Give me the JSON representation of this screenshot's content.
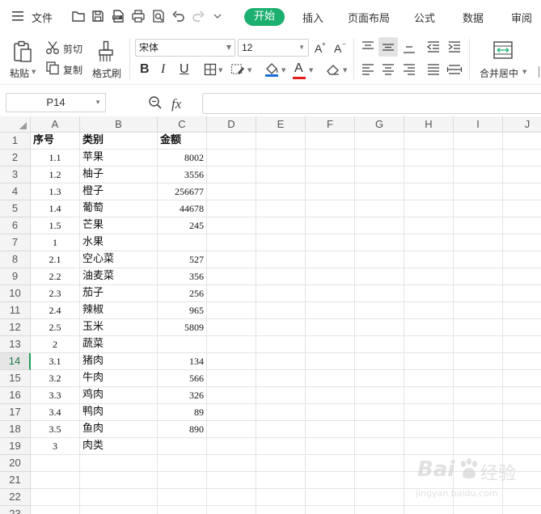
{
  "menubar": {
    "menu_label": "文件",
    "tabs": [
      {
        "label": "开始",
        "active": true
      },
      {
        "label": "插入",
        "active": false
      },
      {
        "label": "页面布局",
        "active": false
      },
      {
        "label": "公式",
        "active": false
      },
      {
        "label": "数据",
        "active": false
      },
      {
        "label": "审阅",
        "active": false
      }
    ],
    "accent_color": "#1bb070"
  },
  "ribbon": {
    "paste_label": "粘贴",
    "cut_label": "剪切",
    "copy_label": "复制",
    "format_painter_label": "格式刷",
    "font_name": "宋体",
    "font_size": "12",
    "bold_glyph": "B",
    "italic_glyph": "I",
    "underline_glyph": "U",
    "font_color_glyph": "A",
    "merge_center_label": "合并居中"
  },
  "formula_bar": {
    "name_box": "P14",
    "fx_label": "fx",
    "formula": ""
  },
  "grid": {
    "columns": [
      "A",
      "B",
      "C",
      "D",
      "E",
      "F",
      "G",
      "H",
      "I",
      "J"
    ],
    "rows": [
      "1",
      "2",
      "3",
      "4",
      "5",
      "6",
      "7",
      "8",
      "9",
      "10",
      "11",
      "12",
      "13",
      "14",
      "15",
      "16",
      "17",
      "18",
      "19",
      "20",
      "21",
      "22",
      "23"
    ],
    "selected_row": "14",
    "cells": [
      [
        "序号",
        "类别",
        "金额"
      ],
      [
        "1.1",
        "苹果",
        "8002"
      ],
      [
        "1.2",
        "柚子",
        "3556"
      ],
      [
        "1.3",
        "橙子",
        "256677"
      ],
      [
        "1.4",
        "葡萄",
        "44678"
      ],
      [
        "1.5",
        "芒果",
        "245"
      ],
      [
        "1",
        "水果",
        ""
      ],
      [
        "2.1",
        "空心菜",
        "527"
      ],
      [
        "2.2",
        "油麦菜",
        "356"
      ],
      [
        "2.3",
        "茄子",
        "256"
      ],
      [
        "2.4",
        "辣椒",
        "965"
      ],
      [
        "2.5",
        "玉米",
        "5809"
      ],
      [
        "2",
        "蔬菜",
        ""
      ],
      [
        "3.1",
        "猪肉",
        "134"
      ],
      [
        "3.2",
        "牛肉",
        "566"
      ],
      [
        "3.3",
        "鸡肉",
        "326"
      ],
      [
        "3.4",
        "鸭肉",
        "89"
      ],
      [
        "3.5",
        "鱼肉",
        "890"
      ],
      [
        "3",
        "肉类",
        ""
      ]
    ]
  },
  "watermark": {
    "brand_text": "Bai",
    "brand_text_2": "经验",
    "url": "jingyan.baidu.com"
  }
}
